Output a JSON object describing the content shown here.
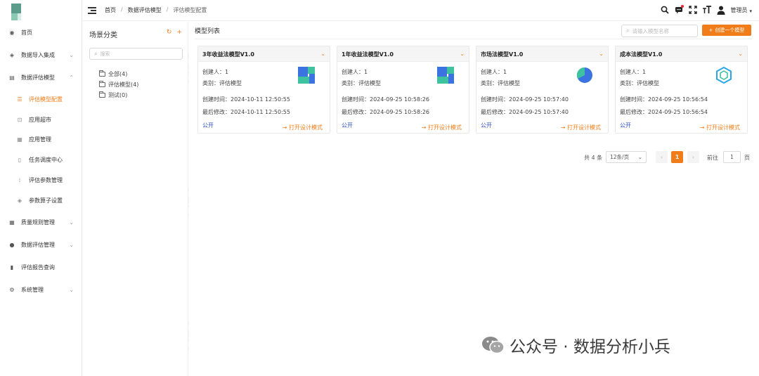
{
  "header": {
    "breadcrumb": [
      "首页",
      "数据评估模型",
      "评估模型配置"
    ],
    "user_name": "管理员"
  },
  "sidebar": {
    "items": [
      {
        "label": "首页",
        "icon": "dashboard-icon"
      },
      {
        "label": "数据导入集成",
        "icon": "layers-icon",
        "chevron": "⌄"
      },
      {
        "label": "数据评估模型",
        "icon": "document-icon",
        "chevron": "⌃"
      },
      {
        "label": "评估模型配置",
        "icon": "config-icon",
        "active": true
      },
      {
        "label": "应用超市",
        "icon": "lock-icon"
      },
      {
        "label": "应用管理",
        "icon": "grid-icon"
      },
      {
        "label": "任务调度中心",
        "icon": "file-icon"
      },
      {
        "label": "评估参数管理",
        "icon": "bars-icon"
      },
      {
        "label": "参数算子设置",
        "icon": "stack-icon"
      },
      {
        "label": "质量规则管理",
        "icon": "table-icon",
        "chevron": "⌄"
      },
      {
        "label": "数据评估管理",
        "icon": "dot-icon",
        "chevron": "⌄"
      },
      {
        "label": "评估报告查询",
        "icon": "bar-chart-icon"
      },
      {
        "label": "系统管理",
        "icon": "gear-icon",
        "chevron": "⌄"
      }
    ]
  },
  "tree": {
    "title": "场景分类",
    "search_placeholder": "搜索",
    "nodes": [
      "全部(4)",
      "评估模型(4)",
      "测试(0)"
    ]
  },
  "main": {
    "title": "模型列表",
    "search_placeholder": "请输入模型名称",
    "create_label": "创建一个模型",
    "cards": [
      {
        "title": "3年收益法模型V1.0",
        "creator": "创建人：1",
        "category": "类别：评估模型",
        "created": "创建时间：2024-10-11 12:50:55",
        "modified": "最后修改：2024-10-11 12:50:55",
        "visibility": "公开",
        "open": "打开设计模式",
        "icon": "blocks-icon"
      },
      {
        "title": "1年收益法模型V1.0",
        "creator": "创建人：1",
        "category": "类别：评估模型",
        "created": "创建时间：2024-09-25 10:58:26",
        "modified": "最后修改：2024-09-25 10:58:26",
        "visibility": "公开",
        "open": "打开设计模式",
        "icon": "blocks-icon"
      },
      {
        "title": "市场法模型V1.0",
        "creator": "创建人：1",
        "category": "类别：评估模型",
        "created": "创建时间：2024-09-25 10:57:40",
        "modified": "最后修改：2024-09-25 10:57:40",
        "visibility": "公开",
        "open": "打开设计模式",
        "icon": "pie-icon"
      },
      {
        "title": "成本法模型V1.0",
        "creator": "创建人：1",
        "category": "类别：评估模型",
        "created": "创建时间：2024-09-25 10:56:54",
        "modified": "最后修改：2024-09-25 10:56:54",
        "visibility": "公开",
        "open": "打开设计模式",
        "icon": "hexagon-icon"
      }
    ]
  },
  "pagination": {
    "total": "共 4 条",
    "page_size": "12条/页",
    "current": "1",
    "goto_prefix": "前往",
    "goto_value": "1",
    "goto_suffix": "页"
  },
  "watermark": "管理员",
  "brand": "公众号 · 数据分析小兵",
  "colors": {
    "accent": "#f07d1a",
    "link": "#2c4fc9"
  }
}
